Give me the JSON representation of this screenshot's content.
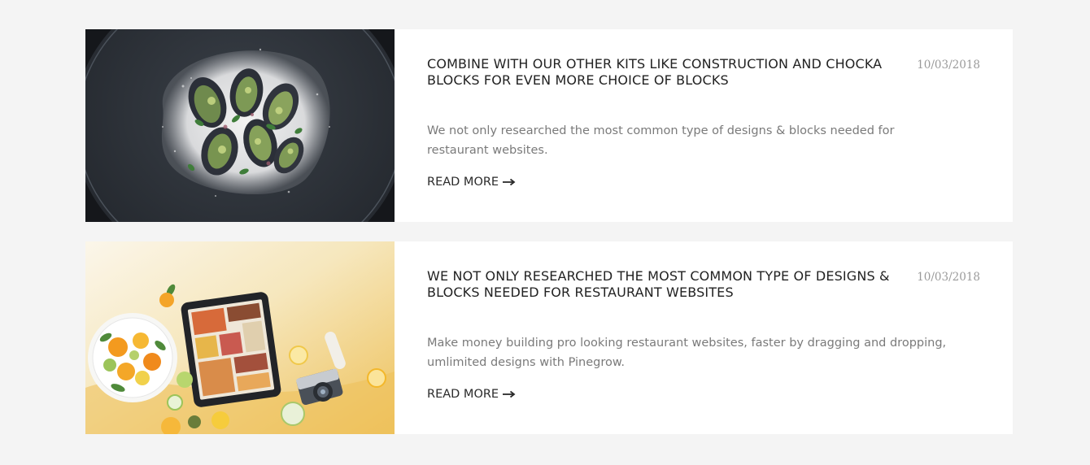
{
  "posts": [
    {
      "image_name": "mussels-dish-photo",
      "title": "COMBINE WITH OUR OTHER KITS LIKE CONSTRUCTION AND CHOCKA BLOCKS FOR EVEN MORE CHOICE OF BLOCKS",
      "date": "10/03/2018",
      "excerpt": "We not only researched the most common type of designs & blocks needed for restaurant websites.",
      "link_label": "READ MORE",
      "link_icon": "arrow-right-icon"
    },
    {
      "image_name": "tablet-and-citrus-photo",
      "title": "WE NOT ONLY RESEARCHED THE MOST COMMON TYPE OF DESIGNS & BLOCKS NEEDED FOR RESTAURANT WEBSITES",
      "date": "10/03/2018",
      "excerpt": "Make money building pro looking restaurant websites, faster by dragging and dropping, umlimited designs with Pinegrow.",
      "link_label": "READ MORE",
      "link_icon": "arrow-right-icon"
    }
  ],
  "colors": {
    "page_background": "#f4f4f4",
    "card_background": "#ffffff",
    "title": "#222222",
    "date": "#9a9a9a",
    "excerpt": "#7a7a7a",
    "link": "#2a2a2a"
  }
}
